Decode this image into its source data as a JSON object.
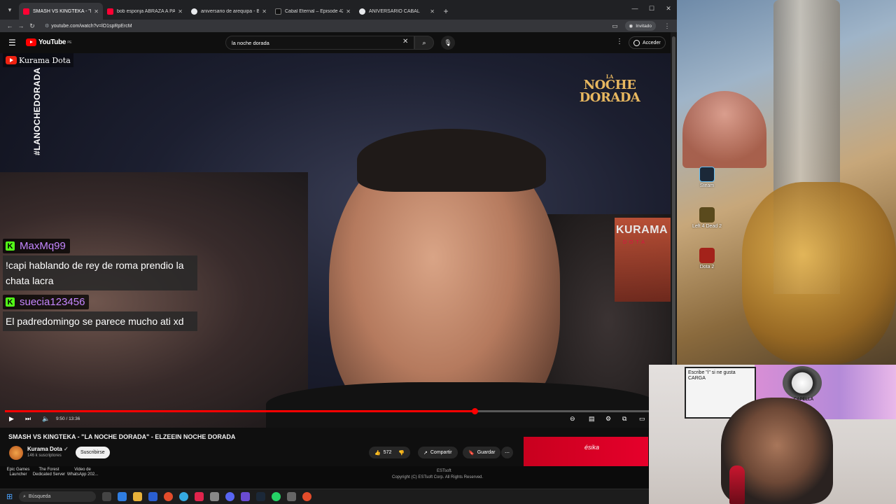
{
  "browser": {
    "tabs": [
      {
        "title": "SMASH VS KINGTEKA - \"LA NOC",
        "active": true,
        "fav_color": "#ff0033"
      },
      {
        "title": "bob esponja ABRAZA A PATRIC",
        "active": false,
        "fav_color": "#ff0033"
      },
      {
        "title": "aniversario de arequipa - Busca",
        "active": false,
        "fav_color": "#e8eaed"
      },
      {
        "title": "Cabal Eternal – Episode 42 – Ru",
        "active": false,
        "fav_color": "#111111"
      },
      {
        "title": "ANIVERSARIO CABAL",
        "active": false,
        "fav_color": "#e8eaed"
      }
    ],
    "url": "youtube.com/watch?v=lO1spRpErcM",
    "profile": "Invitado"
  },
  "youtube": {
    "logo": "YouTube",
    "region": "PE",
    "search_value": "la noche dorada",
    "sign_in": "Acceder"
  },
  "video": {
    "channel_overlay": "Kurama Dota",
    "hashtag": "#LANOCHEDORADA",
    "event_logo_top": "LA",
    "event_logo_line1": "NOCHE",
    "event_logo_line2": "DORADA",
    "watermark": "KURAMA",
    "watermark_sub": "DOTA",
    "chat": [
      {
        "user": "MaxMq99",
        "message": "!capi hablando de rey de roma prendio la chata lacra"
      },
      {
        "user": "suecia123456",
        "message": "El padredomingo se parece mucho ati xd"
      }
    ],
    "progress": 0.71,
    "time": "9:50 / 13:36",
    "accent_color": "#ff0000"
  },
  "below": {
    "title": "SMASH VS KINGTEKA - \"LA NOCHE DORADA\" - ELZEEIN NOCHE DORADA",
    "channel": "Kurama Dota",
    "subscribers": "146 k suscriptores",
    "subscribe": "Suscribirse",
    "likes": "572",
    "share": "Compartir",
    "save": "Guardar",
    "ad_brand": "ésika"
  },
  "desktop": {
    "icons": [
      {
        "label": "Steam"
      },
      {
        "label": "Left 4 Dead 2"
      },
      {
        "label": "Dota 2"
      }
    ],
    "bottom_items": [
      {
        "label": "Epic Games Launcher"
      },
      {
        "label": "The Forest Dedicated Server"
      },
      {
        "label": "Video de WhatsApp 202..."
      }
    ],
    "copyright": "Copyright (C) ESTsoft Corp. All Rights Reserved.",
    "estsoft": "ESTsoft"
  },
  "webcam": {
    "sign_text": "Escribe \"i\" si ne gusta CARGA",
    "logo_text": "CAPELLA"
  },
  "taskbar": {
    "search_placeholder": "Búsqueda"
  }
}
